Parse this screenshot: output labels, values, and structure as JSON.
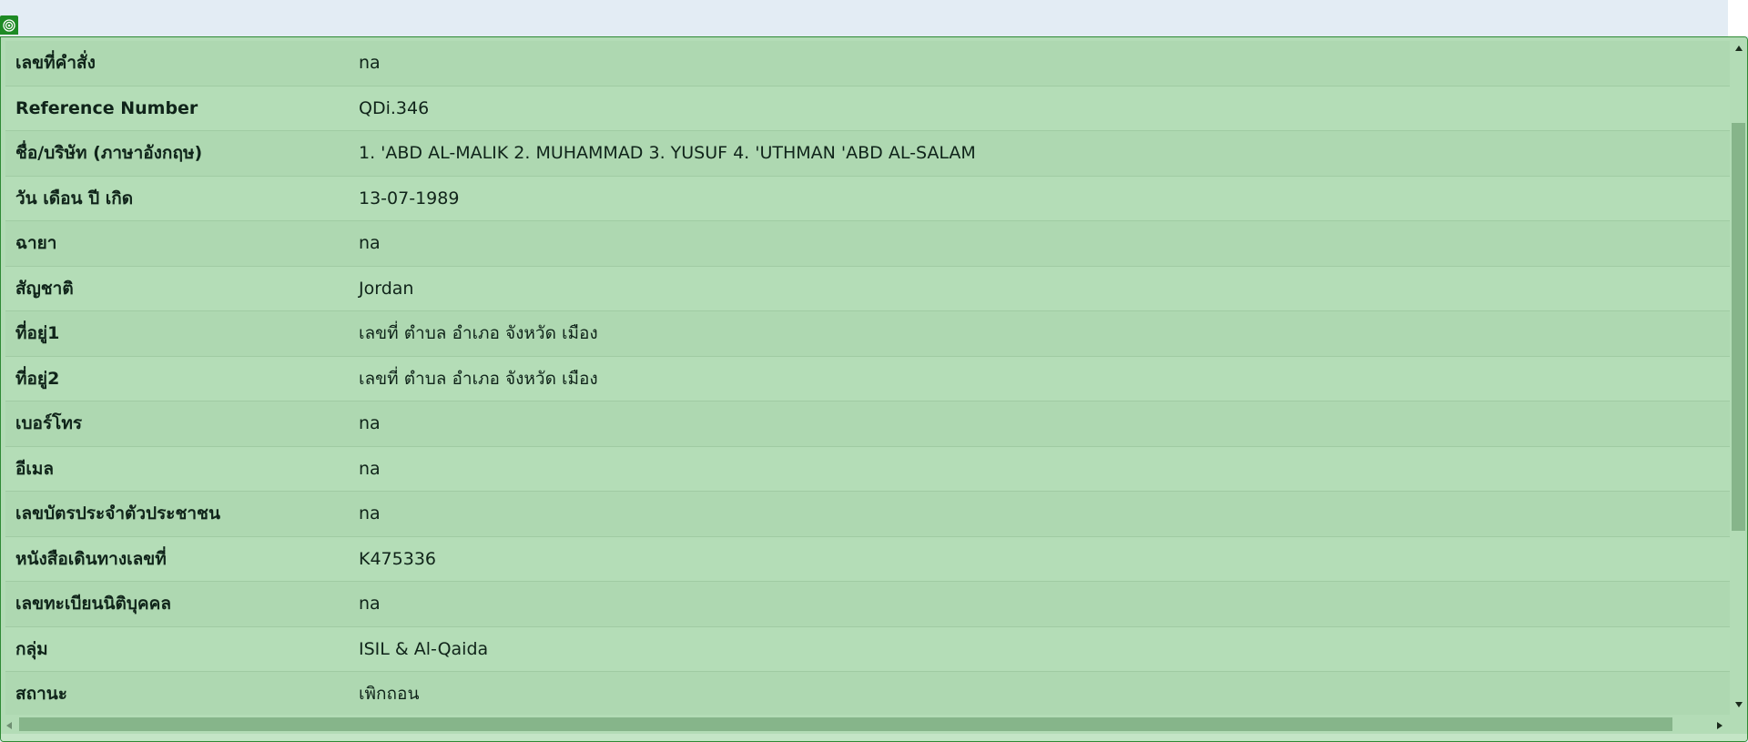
{
  "rows": [
    {
      "label": "เลขที่คำสั่ง",
      "value": "na"
    },
    {
      "label": "Reference Number",
      "value": "QDi.346"
    },
    {
      "label": "ชื่อ/บริษัท (ภาษาอังกฤษ)",
      "value": "1. 'ABD AL-MALIK 2. MUHAMMAD 3. YUSUF 4. 'UTHMAN 'ABD AL-SALAM"
    },
    {
      "label": "วัน เดือน ปี เกิด",
      "value": "13-07-1989"
    },
    {
      "label": "ฉายา",
      "value": "na"
    },
    {
      "label": "สัญชาติ",
      "value": "Jordan"
    },
    {
      "label": "ที่อยู่1",
      "value": "เลขที่ ตำบล อำเภอ จังหวัด เมือง"
    },
    {
      "label": "ที่อยู่2",
      "value": "เลขที่ ตำบล อำเภอ จังหวัด เมือง"
    },
    {
      "label": "เบอร์โทร",
      "value": "na"
    },
    {
      "label": "อีเมล",
      "value": "na"
    },
    {
      "label": "เลขบัตรประจำตัวประชาชน",
      "value": "na"
    },
    {
      "label": "หนังสือเดินทางเลขที่",
      "value": "K475336"
    },
    {
      "label": "เลขทะเบียนนิติบุคคล",
      "value": "na"
    },
    {
      "label": "กลุ่ม",
      "value": "ISIL & Al-Qaida"
    },
    {
      "label": "สถานะ",
      "value": "เพิกถอน"
    }
  ],
  "colors": {
    "panel_bg": "#b3dcb6",
    "panel_border": "#2f8a35",
    "scroll_thumb": "#86b58a",
    "icon_bg": "#1e8a24"
  },
  "icons": {
    "panel_icon": "target-icon",
    "scroll_up": "triangle-up-icon",
    "scroll_down": "triangle-down-icon",
    "scroll_left": "triangle-left-icon",
    "scroll_right": "triangle-right-icon"
  }
}
